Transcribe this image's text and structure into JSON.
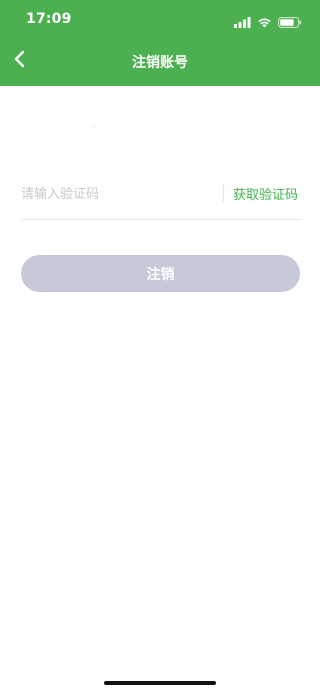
{
  "status_bar": {
    "time": "17:09",
    "signal_icon": "cellular-signal-icon",
    "wifi_icon": "wifi-icon",
    "battery_icon": "battery-icon"
  },
  "nav": {
    "back_icon": "chevron-left-icon",
    "title": "注销账号"
  },
  "form": {
    "phone_masked": "-",
    "phone_masked_2": "·",
    "code_placeholder": "请输入验证码",
    "code_value": "",
    "get_code_label": "获取验证码",
    "submit_label": "注销"
  },
  "colors": {
    "header_bg": "#4caf50",
    "accent_green": "#3cb64a",
    "button_disabled_bg": "#c7c9d9"
  }
}
